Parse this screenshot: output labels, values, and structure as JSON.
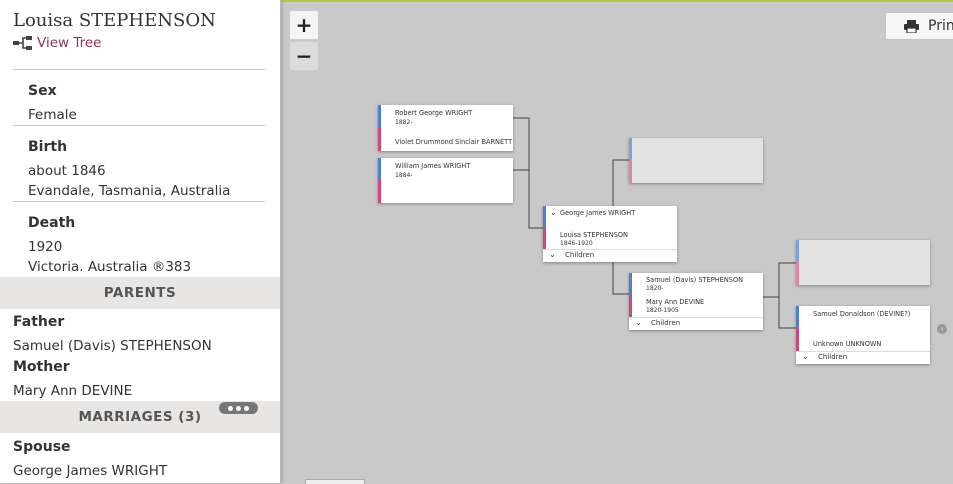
{
  "person": {
    "name": "Louisa STEPHENSON",
    "view_tree": "View Tree",
    "facts": [
      {
        "label": "Sex",
        "lines": [
          "Female"
        ]
      },
      {
        "label": "Birth",
        "lines": [
          "about 1846",
          "Evandale, Tasmania, Australia"
        ]
      },
      {
        "label": "Death",
        "lines": [
          "1920",
          "Victoria. Australia ®383"
        ]
      }
    ]
  },
  "parents": {
    "heading": "PARENTS",
    "father_label": "Father",
    "father": "Samuel (Davis) STEPHENSON",
    "mother_label": "Mother",
    "mother": "Mary Ann DEVINE"
  },
  "marriages": {
    "heading": "MARRIAGES (3)",
    "spouse_label": "Spouse",
    "spouse": "George James WRIGHT"
  },
  "toolbar": {
    "zoom_in": "+",
    "zoom_out": "−",
    "print": "Print"
  },
  "tree": {
    "children_label": "Children",
    "child1": {
      "male_name": "Robert George WRIGHT",
      "male_dates": "1882-",
      "female_name": "Violet Drummond Sinclair BARNETT"
    },
    "child2": {
      "male_name": "William James WRIGHT",
      "male_dates": "1884-"
    },
    "focus": {
      "male_name": "George James WRIGHT",
      "female_name": "Louisa STEPHENSON",
      "female_dates": "1846-1920"
    },
    "parents": {
      "male_name": "Samuel (Davis) STEPHENSON",
      "male_dates": "1820-",
      "female_name": "Mary Ann DEVINE",
      "female_dates": "1820-1905"
    },
    "grandparents": {
      "male_name": "Samuel Donaldson (DEVINE?)",
      "female_name": "Unknown UNKNOWN"
    }
  }
}
